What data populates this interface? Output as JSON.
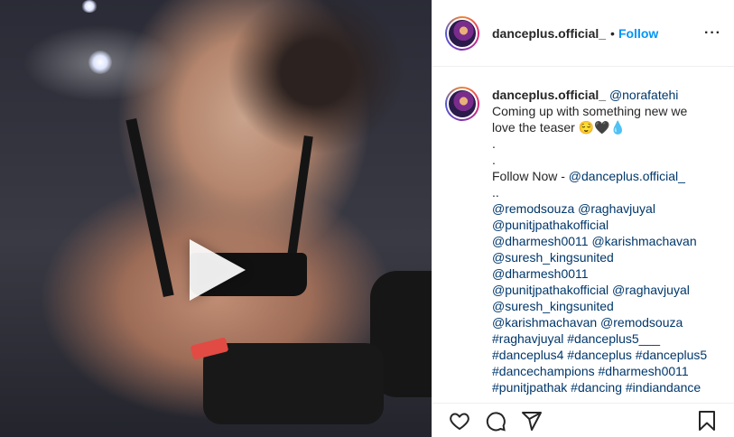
{
  "post": {
    "username": "danceplus.official_",
    "separator": "•",
    "follow_label": "Follow",
    "more_label": "···"
  },
  "caption": {
    "username": "danceplus.official_",
    "lines": [
      "@norafatehi",
      "Coming up with something new we",
      "love the teaser 😌🖤💧",
      ".",
      ".",
      "Follow Now - ",
      "..",
      "@remodsouza @raghavjuyal",
      "@punitjpathakofficial",
      "@dharmesh0011 @karishmachavan",
      "@suresh_kingsunited",
      "@dharmesh0011",
      "@punitjpathakofficial @raghavjuyal",
      "@suresh_kingsunited",
      "@karishmachavan @remodsouza",
      "#raghavjuyal #danceplus5___",
      "#danceplus4 #danceplus #danceplus5",
      "#dancechampions #dharmesh0011",
      "#punitjpathak #dancing #indiandance"
    ],
    "follow_now_link": "@danceplus.official_"
  },
  "icons": {
    "play": "play-icon",
    "like": "heart-icon",
    "comment": "comment-icon",
    "share": "paper-plane-icon",
    "save": "bookmark-icon"
  },
  "colors": {
    "link": "#00376b",
    "follow": "#0095f6",
    "text": "#262626"
  }
}
